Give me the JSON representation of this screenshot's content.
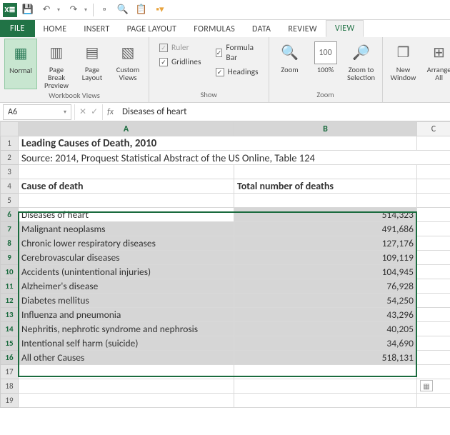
{
  "qat": {
    "excel_icon": "X≣"
  },
  "tabs": {
    "file": "FILE",
    "items": [
      "HOME",
      "INSERT",
      "PAGE LAYOUT",
      "FORMULAS",
      "DATA",
      "REVIEW",
      "VIEW"
    ],
    "active": "VIEW"
  },
  "ribbon": {
    "workbookViews": {
      "label": "Workbook Views",
      "normal": "Normal",
      "pageBreak": "Page Break Preview",
      "pageLayout": "Page Layout",
      "custom": "Custom Views"
    },
    "show": {
      "label": "Show",
      "ruler": "Ruler",
      "gridlines": "Gridlines",
      "formulaBar": "Formula Bar",
      "headings": "Headings"
    },
    "zoom": {
      "label": "Zoom",
      "zoom": "Zoom",
      "hundred": "100%",
      "toSelection": "Zoom to Selection"
    },
    "window": {
      "new": "New Window",
      "arrange": "Arrange All"
    }
  },
  "formulaBar": {
    "cellRef": "A6",
    "fxLabel": "fx",
    "content": "Diseases of heart"
  },
  "columns": [
    "A",
    "B",
    "C"
  ],
  "cells": {
    "r1": {
      "a": "Leading Causes of Death, 2010"
    },
    "r2": {
      "a": "Source: 2014, Proquest Statistical Abstract of the US Online, Table 124"
    },
    "r4": {
      "a": "Cause of death",
      "b": "Total number of deaths"
    }
  },
  "rows": [
    {
      "cause": "Diseases of heart",
      "total": "514,323"
    },
    {
      "cause": "Malignant neoplasms",
      "total": "491,686"
    },
    {
      "cause": "Chronic lower respiratory diseases",
      "total": "127,176"
    },
    {
      "cause": "Cerebrovascular diseases",
      "total": "109,119"
    },
    {
      "cause": "Accidents (unintentional injuries)",
      "total": "104,945"
    },
    {
      "cause": "Alzheimer's disease",
      "total": "76,928"
    },
    {
      "cause": "Diabetes mellitus",
      "total": "54,250"
    },
    {
      "cause": "Influenza and pneumonia",
      "total": "43,296"
    },
    {
      "cause": "Nephritis, nephrotic syndrome and nephrosis",
      "total": "40,205"
    },
    {
      "cause": "Intentional self harm (suicide)",
      "total": "34,690"
    },
    {
      "cause": "All other Causes",
      "total": "518,131"
    }
  ],
  "chart_data": {
    "type": "table",
    "title": "Leading Causes of Death, 2010",
    "source": "Source: 2014, Proquest Statistical Abstract of the US Online, Table 124",
    "columns": [
      "Cause of death",
      "Total number of deaths"
    ],
    "categories": [
      "Diseases of heart",
      "Malignant neoplasms",
      "Chronic lower respiratory diseases",
      "Cerebrovascular diseases",
      "Accidents (unintentional injuries)",
      "Alzheimer's disease",
      "Diabetes mellitus",
      "Influenza and pneumonia",
      "Nephritis, nephrotic syndrome and nephrosis",
      "Intentional self harm (suicide)",
      "All other Causes"
    ],
    "values": [
      514323,
      491686,
      127176,
      109119,
      104945,
      76928,
      54250,
      43296,
      40205,
      34690,
      518131
    ]
  }
}
